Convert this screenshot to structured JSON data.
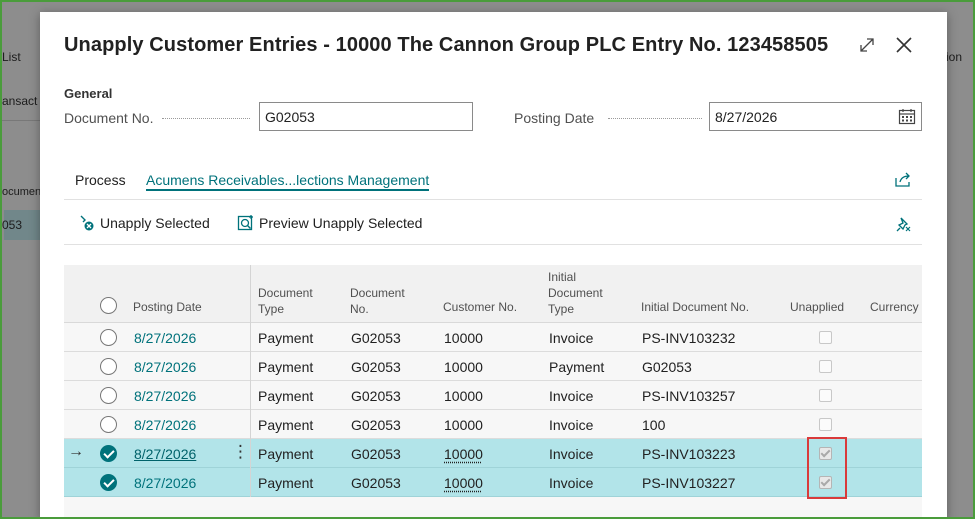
{
  "background": {
    "labels": [
      "List",
      "ansact",
      "ocumen",
      "053",
      "ption"
    ]
  },
  "dialog": {
    "title": "Unapply Customer Entries - 10000 The Cannon Group PLC Entry No. 123458505",
    "expand_icon": "expand-icon",
    "close_icon": "close-icon",
    "general": {
      "label": "General",
      "document_no_label": "Document No.",
      "document_no_value": "G02053",
      "posting_date_label": "Posting Date",
      "posting_date_value": "8/27/2026"
    },
    "tabs": [
      {
        "label": "Process",
        "active": false
      },
      {
        "label": "Acumens Receivables...lections Management",
        "active": true
      }
    ],
    "actions": {
      "unapply_selected": "Unapply Selected",
      "preview_unapply_selected": "Preview Unapply Selected"
    },
    "grid": {
      "columns": {
        "posting_date": "Posting Date",
        "document_type": "Document Type",
        "document_no": "Document No.",
        "customer_no": "Customer No.",
        "initial_document_type": "Initial Document Type",
        "initial_document_no": "Initial Document No.",
        "unapplied": "Unapplied",
        "currency": "Currency"
      },
      "rows": [
        {
          "posting_date": "8/27/2026",
          "document_type": "Payment",
          "document_no": "G02053",
          "customer_no": "10000",
          "initial_document_type": "Invoice",
          "initial_document_no": "PS-INV103232",
          "unapplied": false,
          "selected": false
        },
        {
          "posting_date": "8/27/2026",
          "document_type": "Payment",
          "document_no": "G02053",
          "customer_no": "10000",
          "initial_document_type": "Payment",
          "initial_document_no": "G02053",
          "unapplied": false,
          "selected": false
        },
        {
          "posting_date": "8/27/2026",
          "document_type": "Payment",
          "document_no": "G02053",
          "customer_no": "10000",
          "initial_document_type": "Invoice",
          "initial_document_no": "PS-INV103257",
          "unapplied": false,
          "selected": false
        },
        {
          "posting_date": "8/27/2026",
          "document_type": "Payment",
          "document_no": "G02053",
          "customer_no": "10000",
          "initial_document_type": "Invoice",
          "initial_document_no": "100",
          "unapplied": false,
          "selected": false
        },
        {
          "posting_date": "8/27/2026",
          "document_type": "Payment",
          "document_no": "G02053",
          "customer_no": "10000",
          "initial_document_type": "Invoice",
          "initial_document_no": "PS-INV103223",
          "unapplied": true,
          "selected": true
        },
        {
          "posting_date": "8/27/2026",
          "document_type": "Payment",
          "document_no": "G02053",
          "customer_no": "10000",
          "initial_document_type": "Invoice",
          "initial_document_no": "PS-INV103227",
          "unapplied": true,
          "selected": true
        }
      ]
    }
  },
  "colors": {
    "accent": "#00727b",
    "selected_row": "#b2e4e9",
    "highlight_box": "#d93a3a",
    "frame": "#4a9c3b"
  }
}
